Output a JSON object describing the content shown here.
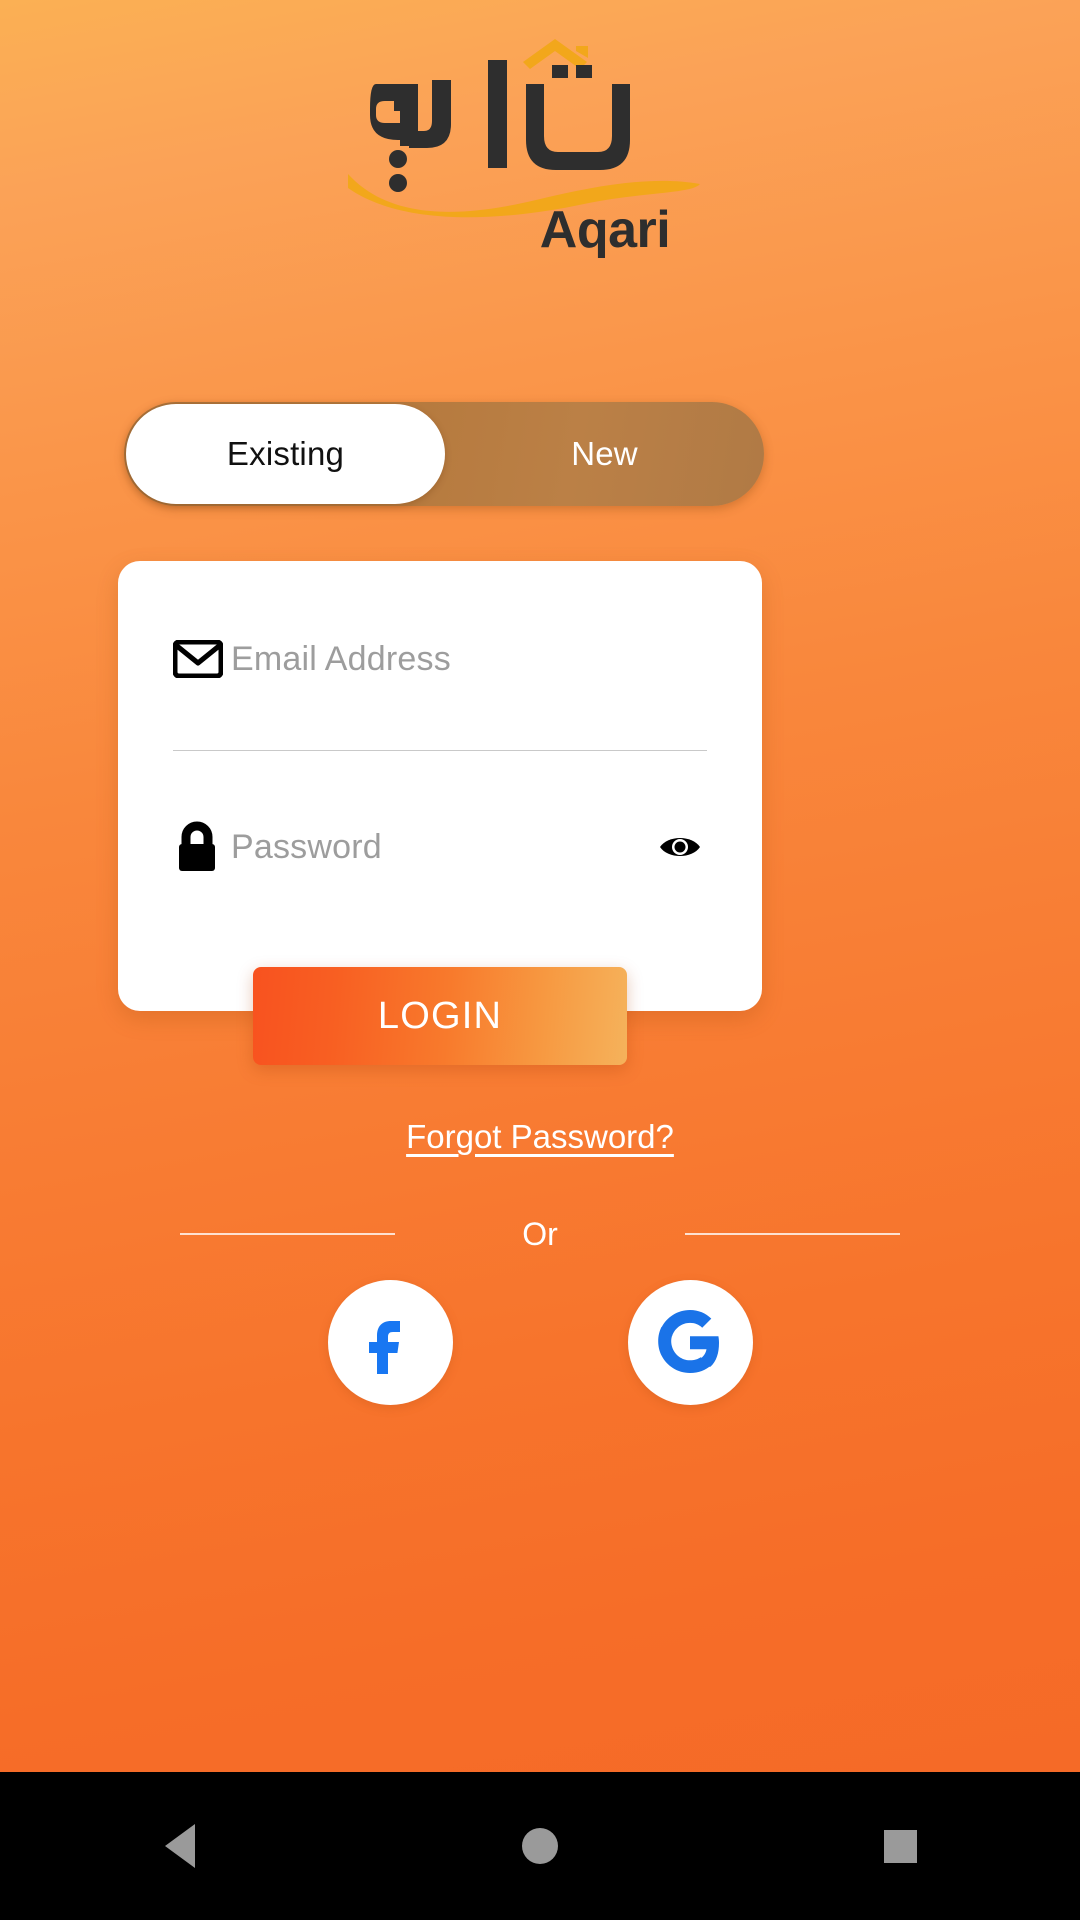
{
  "theme": {
    "bg_top": "#fbb054",
    "bg_bottom": "#f56a27",
    "logo_dark": "#2e2e2e",
    "logo_gold": "#f2a71b",
    "toggle_track": "#b5793d",
    "login_gradient_from": "#f8521f",
    "login_gradient_to": "#f5b25b",
    "facebook_blue": "#1877F2",
    "google_blue": "#1a73e8",
    "placeholder_gray": "#9d9d9d"
  },
  "logo": {
    "arabic_wordmark": "عقاري",
    "latin_wordmark": "Aqari",
    "icon_roof": "house-roof-icon",
    "icon_swoosh": "gold-swoosh-icon"
  },
  "toggle": {
    "selected": "Existing",
    "options": [
      {
        "label": "Existing",
        "selected": true
      },
      {
        "label": "New",
        "selected": false
      }
    ]
  },
  "form": {
    "email": {
      "icon": "envelope-icon",
      "placeholder": "Email Address",
      "value": ""
    },
    "password": {
      "icon": "lock-icon",
      "placeholder": "Password",
      "value": "",
      "reveal_icon": "eye-icon"
    }
  },
  "actions": {
    "login_label": "LOGIN",
    "forgot_label": "Forgot Password?"
  },
  "divider": {
    "text": "Or"
  },
  "social": [
    {
      "name": "facebook",
      "glyph": "f",
      "color": "#1877F2"
    },
    {
      "name": "google",
      "glyph": "G",
      "color": "#1a73e8"
    }
  ],
  "navbar": {
    "back": "back-triangle",
    "home": "home-circle",
    "recent": "recent-square"
  }
}
